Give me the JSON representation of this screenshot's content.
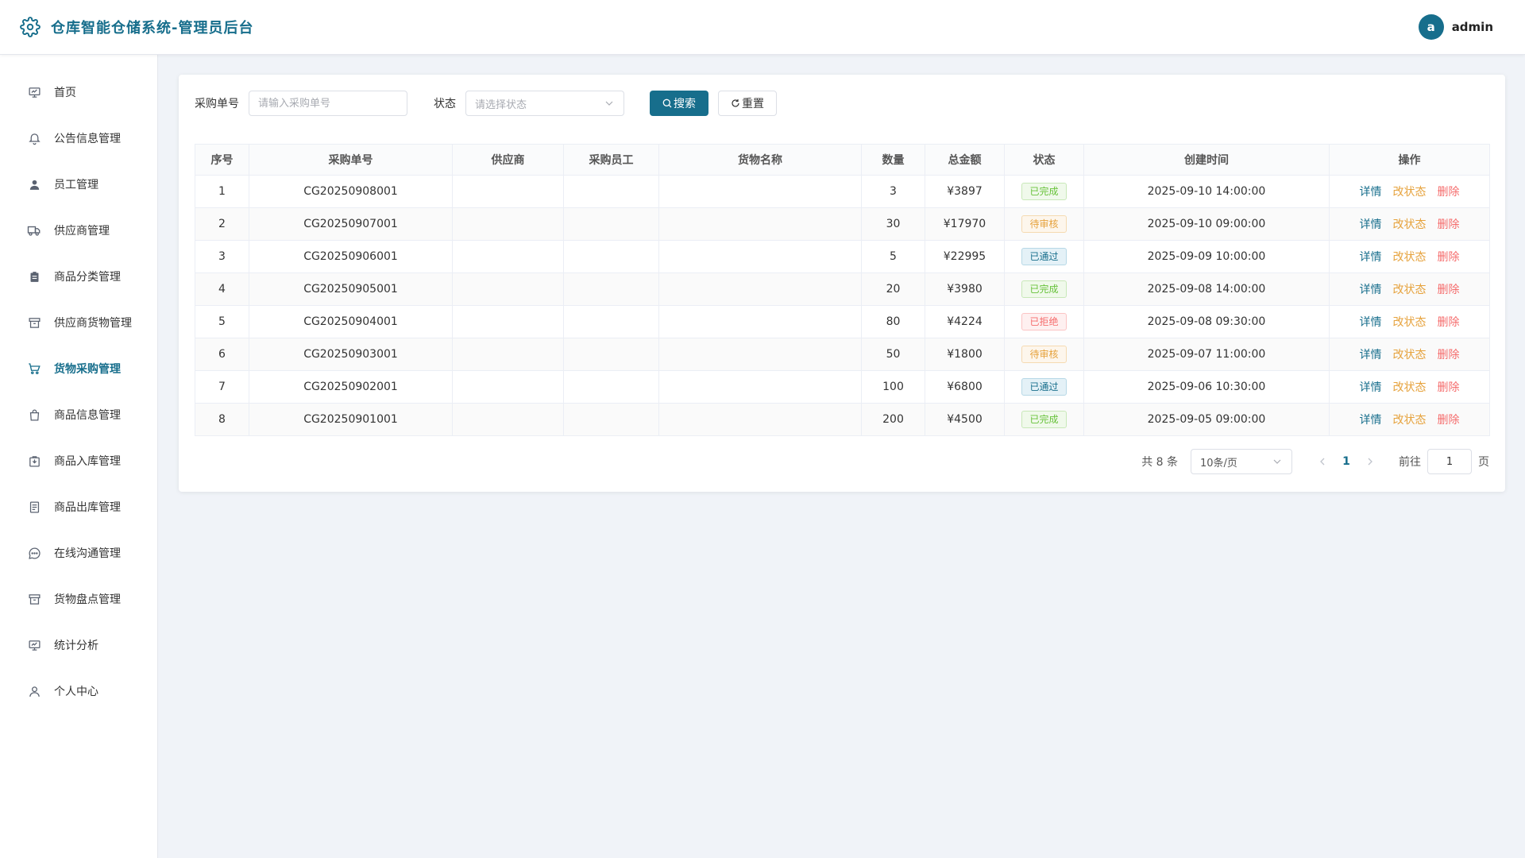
{
  "header": {
    "title": "仓库智能仓储系统-管理员后台",
    "avatar_letter": "a",
    "user_name": "admin",
    "logo_icon": "gear-icon"
  },
  "sidebar": {
    "items": [
      {
        "label": "首页",
        "icon": "dashboard-icon"
      },
      {
        "label": "公告信息管理",
        "icon": "bell-icon"
      },
      {
        "label": "员工管理",
        "icon": "user-solid-icon"
      },
      {
        "label": "供应商管理",
        "icon": "truck-icon"
      },
      {
        "label": "商品分类管理",
        "icon": "clipboard-icon"
      },
      {
        "label": "供应商货物管理",
        "icon": "box-icon"
      },
      {
        "label": "货物采购管理",
        "icon": "cart-icon",
        "active": true
      },
      {
        "label": "商品信息管理",
        "icon": "bag-icon"
      },
      {
        "label": "商品入库管理",
        "icon": "inbox-icon"
      },
      {
        "label": "商品出库管理",
        "icon": "document-icon"
      },
      {
        "label": "在线沟通管理",
        "icon": "chat-icon"
      },
      {
        "label": "货物盘点管理",
        "icon": "archive-icon"
      },
      {
        "label": "统计分析",
        "icon": "chart-icon"
      },
      {
        "label": "个人中心",
        "icon": "user-icon"
      }
    ]
  },
  "search": {
    "order_label": "采购单号",
    "order_placeholder": "请输入采购单号",
    "status_label": "状态",
    "status_placeholder": "请选择状态",
    "search_button": "搜索",
    "reset_button": "重置"
  },
  "table": {
    "columns": [
      "序号",
      "采购单号",
      "供应商",
      "采购员工",
      "货物名称",
      "数量",
      "总金额",
      "状态",
      "创建时间",
      "操作"
    ],
    "rows": [
      {
        "no": "1",
        "order": "CG20250908001",
        "supplier": "",
        "staff": "",
        "goods": "",
        "qty": "3",
        "amount": "¥3897",
        "status": "已完成",
        "status_type": "done",
        "created": "2025-09-10 14:00:00"
      },
      {
        "no": "2",
        "order": "CG20250907001",
        "supplier": "",
        "staff": "",
        "goods": "",
        "qty": "30",
        "amount": "¥17970",
        "status": "待审核",
        "status_type": "pending",
        "created": "2025-09-10 09:00:00"
      },
      {
        "no": "3",
        "order": "CG20250906001",
        "supplier": "",
        "staff": "",
        "goods": "",
        "qty": "5",
        "amount": "¥22995",
        "status": "已通过",
        "status_type": "passed",
        "created": "2025-09-09 10:00:00"
      },
      {
        "no": "4",
        "order": "CG20250905001",
        "supplier": "",
        "staff": "",
        "goods": "",
        "qty": "20",
        "amount": "¥3980",
        "status": "已完成",
        "status_type": "done",
        "created": "2025-09-08 14:00:00"
      },
      {
        "no": "5",
        "order": "CG20250904001",
        "supplier": "",
        "staff": "",
        "goods": "",
        "qty": "80",
        "amount": "¥4224",
        "status": "已拒绝",
        "status_type": "rejected",
        "created": "2025-09-08 09:30:00"
      },
      {
        "no": "6",
        "order": "CG20250903001",
        "supplier": "",
        "staff": "",
        "goods": "",
        "qty": "50",
        "amount": "¥1800",
        "status": "待审核",
        "status_type": "pending",
        "created": "2025-09-07 11:00:00"
      },
      {
        "no": "7",
        "order": "CG20250902001",
        "supplier": "",
        "staff": "",
        "goods": "",
        "qty": "100",
        "amount": "¥6800",
        "status": "已通过",
        "status_type": "passed",
        "created": "2025-09-06 10:30:00"
      },
      {
        "no": "8",
        "order": "CG20250901001",
        "supplier": "",
        "staff": "",
        "goods": "",
        "qty": "200",
        "amount": "¥4500",
        "status": "已完成",
        "status_type": "done",
        "created": "2025-09-05 09:00:00"
      }
    ],
    "ops": {
      "detail": "详情",
      "change": "改状态",
      "delete": "删除"
    }
  },
  "pagination": {
    "total": "共 8 条",
    "page_size": "10条/页",
    "current_page": "1",
    "goto_label": "前往",
    "goto_value": "1",
    "page_suffix": "页"
  },
  "colors": {
    "primary": "#176e8c",
    "warning": "#e6a23c",
    "danger": "#f56c6c",
    "success": "#67c23a"
  }
}
